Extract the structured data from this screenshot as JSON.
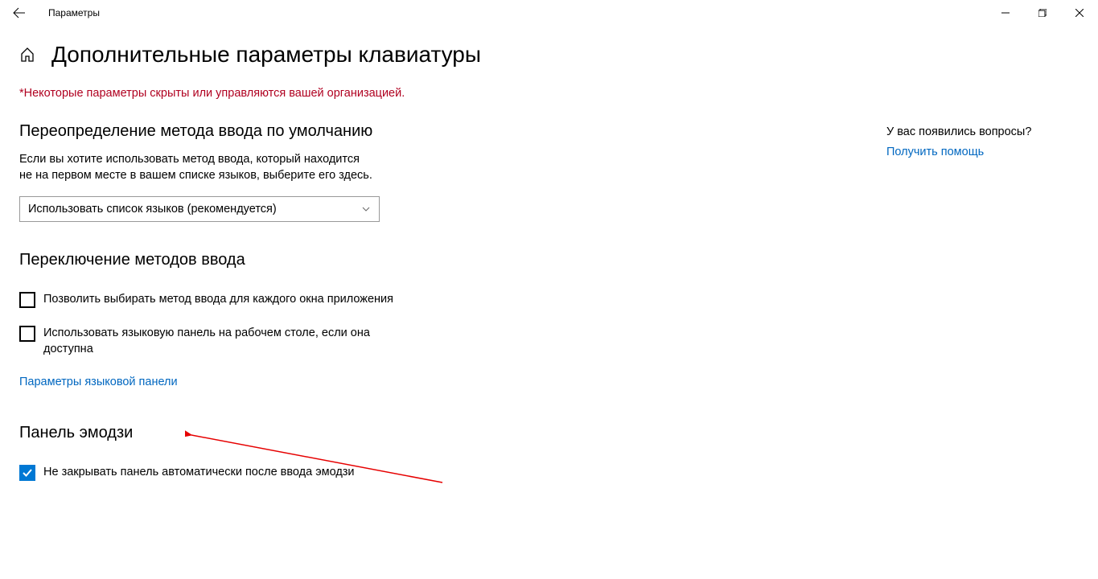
{
  "titlebar": {
    "title": "Параметры"
  },
  "page": {
    "title": "Дополнительные параметры клавиатуры",
    "org_warning": "*Некоторые параметры скрыты или управляются вашей организацией."
  },
  "section1": {
    "heading": "Переопределение метода ввода по умолчанию",
    "description": "Если вы хотите использовать метод ввода, который находится не на первом месте в вашем списке языков, выберите его здесь.",
    "dropdown_value": "Использовать список языков (рекомендуется)"
  },
  "section2": {
    "heading": "Переключение методов ввода",
    "checkbox1_label": "Позволить выбирать метод ввода для каждого окна приложения",
    "checkbox1_checked": false,
    "checkbox2_label": "Использовать языковую панель на рабочем столе, если она доступна",
    "checkbox2_checked": false,
    "link": "Параметры языковой панели"
  },
  "section3": {
    "heading": "Панель эмодзи",
    "checkbox1_label": "Не закрывать панель автоматически после ввода эмодзи",
    "checkbox1_checked": true
  },
  "help": {
    "question": "У вас появились вопросы?",
    "link": "Получить помощь"
  }
}
